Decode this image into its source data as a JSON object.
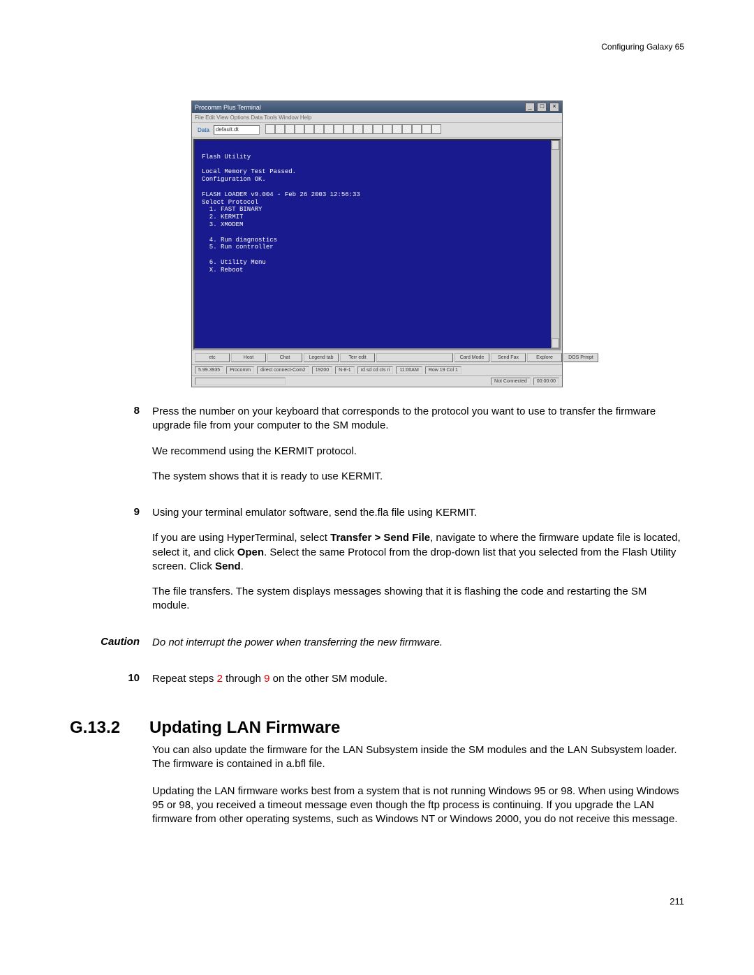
{
  "header": {
    "chapter": "Configuring Galaxy 65"
  },
  "figure": {
    "window_title": "Procomm Plus Terminal",
    "menubar": "File Edit View Options Data Tools Window Help",
    "toolbar": {
      "label": "Data",
      "combo": "default.dt"
    },
    "terminal_lines": [
      "",
      "Flash Utility",
      "",
      "Local Memory Test Passed.",
      "Configuration OK.",
      "",
      "FLASH LOADER v9.004 - Feb 26 2003 12:56:33",
      "Select Protocol",
      "  1. FAST BINARY",
      "  2. KERMIT",
      "  3. XMODEM",
      "",
      "  4. Run diagnostics",
      "  5. Run controller",
      "",
      "  6. Utility Menu",
      "  X. Reboot"
    ],
    "buttons": [
      "etc",
      "Host",
      "Chat",
      "Legend tab",
      "Terr edit",
      "",
      "",
      "",
      "Card Mode",
      "Send Fax",
      "Explore",
      "DOS Prmpt"
    ],
    "status": {
      "cells": [
        "5.99.3935",
        "Procomm",
        "direct connect-Com2",
        "19200",
        "N-8-1",
        "rd sd cd cts ri",
        "11:00AM",
        "Row 19  Col 1"
      ],
      "right": [
        "Not Connected",
        "00:00:00"
      ]
    }
  },
  "steps": {
    "s8": {
      "num": "8",
      "p1": "Press the number on your keyboard that corresponds to the protocol you want to use to transfer the firmware upgrade file from your computer to the SM module.",
      "p2": "We recommend using the KERMIT protocol.",
      "p3": "The system shows that it is ready to use KERMIT."
    },
    "s9": {
      "num": "9",
      "p1": "Using your terminal emulator software, send the.fla file using KERMIT.",
      "p2_a": "If you are using HyperTerminal, select ",
      "p2_b": "Transfer > Send File",
      "p2_c": ", navigate to where the firmware update file is located, select it, and click ",
      "p2_d": "Open",
      "p2_e": ". Select the same Protocol from the drop-down list that you selected from the Flash Utility screen. Click ",
      "p2_f": "Send",
      "p2_g": ".",
      "p3": "The file transfers. The system displays messages showing that it is flashing the code and restarting the SM module."
    },
    "caution": {
      "label": "Caution",
      "text": "Do not interrupt the power when transferring the new firmware."
    },
    "s10": {
      "num": "10",
      "t1": "Repeat steps ",
      "t2": "2",
      "t3": " through ",
      "t4": "9",
      "t5": " on the other SM module."
    }
  },
  "section": {
    "num": "G.13.2",
    "title": "Updating LAN Firmware",
    "p1": "You can also update the firmware for the LAN Subsystem inside the SM modules and the LAN Subsystem loader. The firmware is contained in a.bfl file.",
    "p2_a": "Updating the LAN firmware works best from a system that is ",
    "p2_b": "not",
    "p2_c": " running Windows 95 or 98. When using Windows 95 or 98, you received a timeout message even though the ftp process is continuing. If you upgrade the LAN firmware from other operating systems, such as Windows NT or Windows 2000, you do not receive this message."
  },
  "footer": {
    "pagenum": "211"
  }
}
